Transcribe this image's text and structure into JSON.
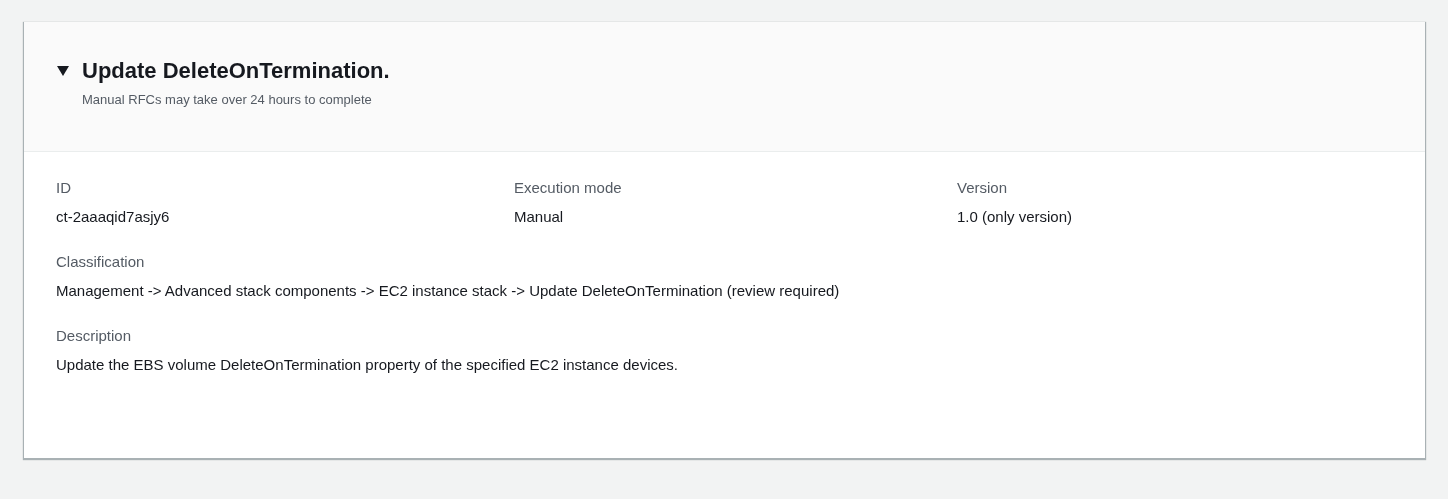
{
  "panel": {
    "title": "Update DeleteOnTermination.",
    "expanded": true,
    "subtitle": "Manual RFCs may take over 24 hours to complete"
  },
  "fields": [
    {
      "label": "ID",
      "value": "ct-2aaaqid7asjy6"
    },
    {
      "label": "Execution mode",
      "value": "Manual"
    },
    {
      "label": "Version",
      "value": "1.0 (only version)"
    }
  ],
  "details": [
    {
      "label": "Classification",
      "value": "Management -> Advanced stack components -> EC2 instance stack -> Update DeleteOnTermination (review required)"
    },
    {
      "label": "Description",
      "value": "Update the EBS volume DeleteOnTermination property of the specified EC2 instance devices."
    }
  ]
}
